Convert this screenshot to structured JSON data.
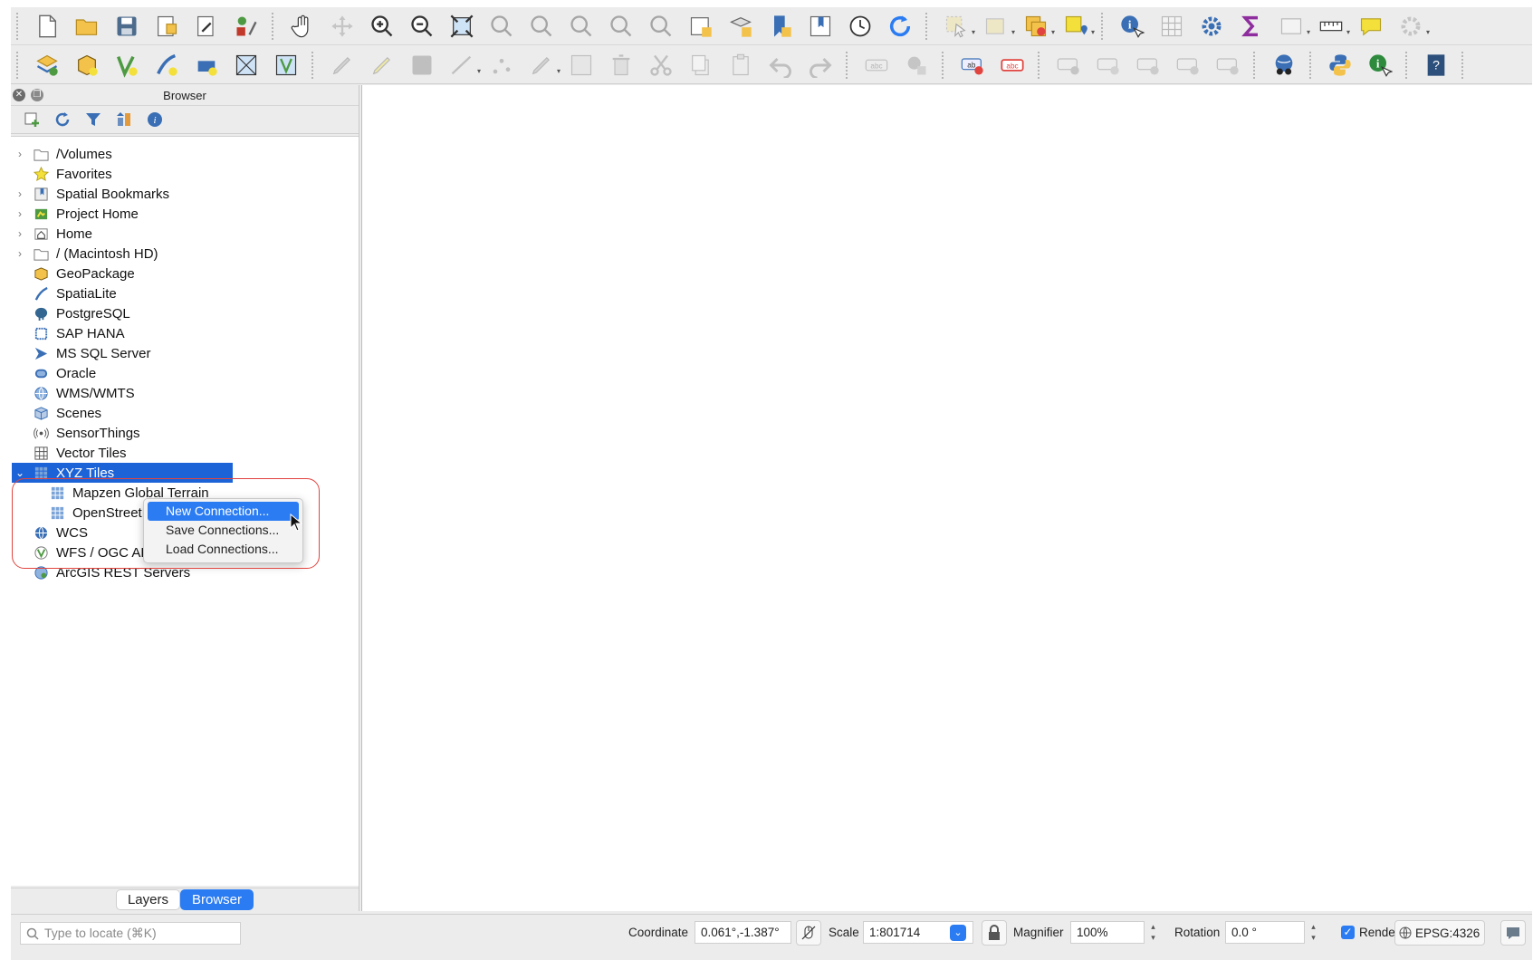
{
  "browser": {
    "title": "Browser",
    "tree": [
      {
        "label": "/Volumes",
        "icon": "folder-icon",
        "expandable": true
      },
      {
        "label": "Favorites",
        "icon": "star-icon",
        "expandable": false
      },
      {
        "label": "Spatial Bookmarks",
        "icon": "bookmarks-icon",
        "expandable": true
      },
      {
        "label": "Project Home",
        "icon": "project-home-icon",
        "expandable": true
      },
      {
        "label": "Home",
        "icon": "home-icon",
        "expandable": true
      },
      {
        "label": "/ (Macintosh HD)",
        "icon": "folder-icon",
        "expandable": true
      },
      {
        "label": "GeoPackage",
        "icon": "geopackage-icon",
        "expandable": false
      },
      {
        "label": "SpatiaLite",
        "icon": "spatialite-icon",
        "expandable": false
      },
      {
        "label": "PostgreSQL",
        "icon": "postgresql-icon",
        "expandable": false
      },
      {
        "label": "SAP HANA",
        "icon": "sap-hana-icon",
        "expandable": false
      },
      {
        "label": "MS SQL Server",
        "icon": "mssql-icon",
        "expandable": false
      },
      {
        "label": "Oracle",
        "icon": "oracle-icon",
        "expandable": false
      },
      {
        "label": "WMS/WMTS",
        "icon": "wms-icon",
        "expandable": false
      },
      {
        "label": "Scenes",
        "icon": "scenes-icon",
        "expandable": false
      },
      {
        "label": "SensorThings",
        "icon": "sensorthings-icon",
        "expandable": false
      },
      {
        "label": "Vector Tiles",
        "icon": "vector-tiles-icon",
        "expandable": false
      },
      {
        "label": "XYZ Tiles",
        "icon": "xyz-tiles-icon",
        "expandable": true,
        "selected": true
      },
      {
        "label": "Mapzen Global Terrain",
        "icon": "xyz-tiles-icon",
        "child": true
      },
      {
        "label": "OpenStreetMap",
        "icon": "xyz-tiles-icon",
        "child": true
      },
      {
        "label": "WCS",
        "icon": "wcs-icon",
        "expandable": false
      },
      {
        "label": "WFS / OGC API - Features",
        "icon": "wfs-icon",
        "expandable": false
      },
      {
        "label": "ArcGIS REST Servers",
        "icon": "arcgis-icon",
        "expandable": false
      }
    ],
    "tabs": {
      "layers": "Layers",
      "browser": "Browser"
    }
  },
  "context_menu": {
    "items": [
      "New Connection...",
      "Save Connections...",
      "Load Connections..."
    ],
    "highlighted_index": 0
  },
  "statusbar": {
    "locator_placeholder": "Type to locate (⌘K)",
    "coordinate_label": "Coordinate",
    "coordinate_value": "0.061°,-1.387°",
    "scale_label": "Scale",
    "scale_value": "1:801714",
    "magnifier_label": "Magnifier",
    "magnifier_value": "100%",
    "rotation_label": "Rotation",
    "rotation_value": "0.0 °",
    "render_label": "Render",
    "crs_value": "EPSG:4326"
  },
  "colors": {
    "selection": "#1d63d8",
    "menu_highlight": "#2b7cf2",
    "annotation_outline": "#e1443f"
  }
}
